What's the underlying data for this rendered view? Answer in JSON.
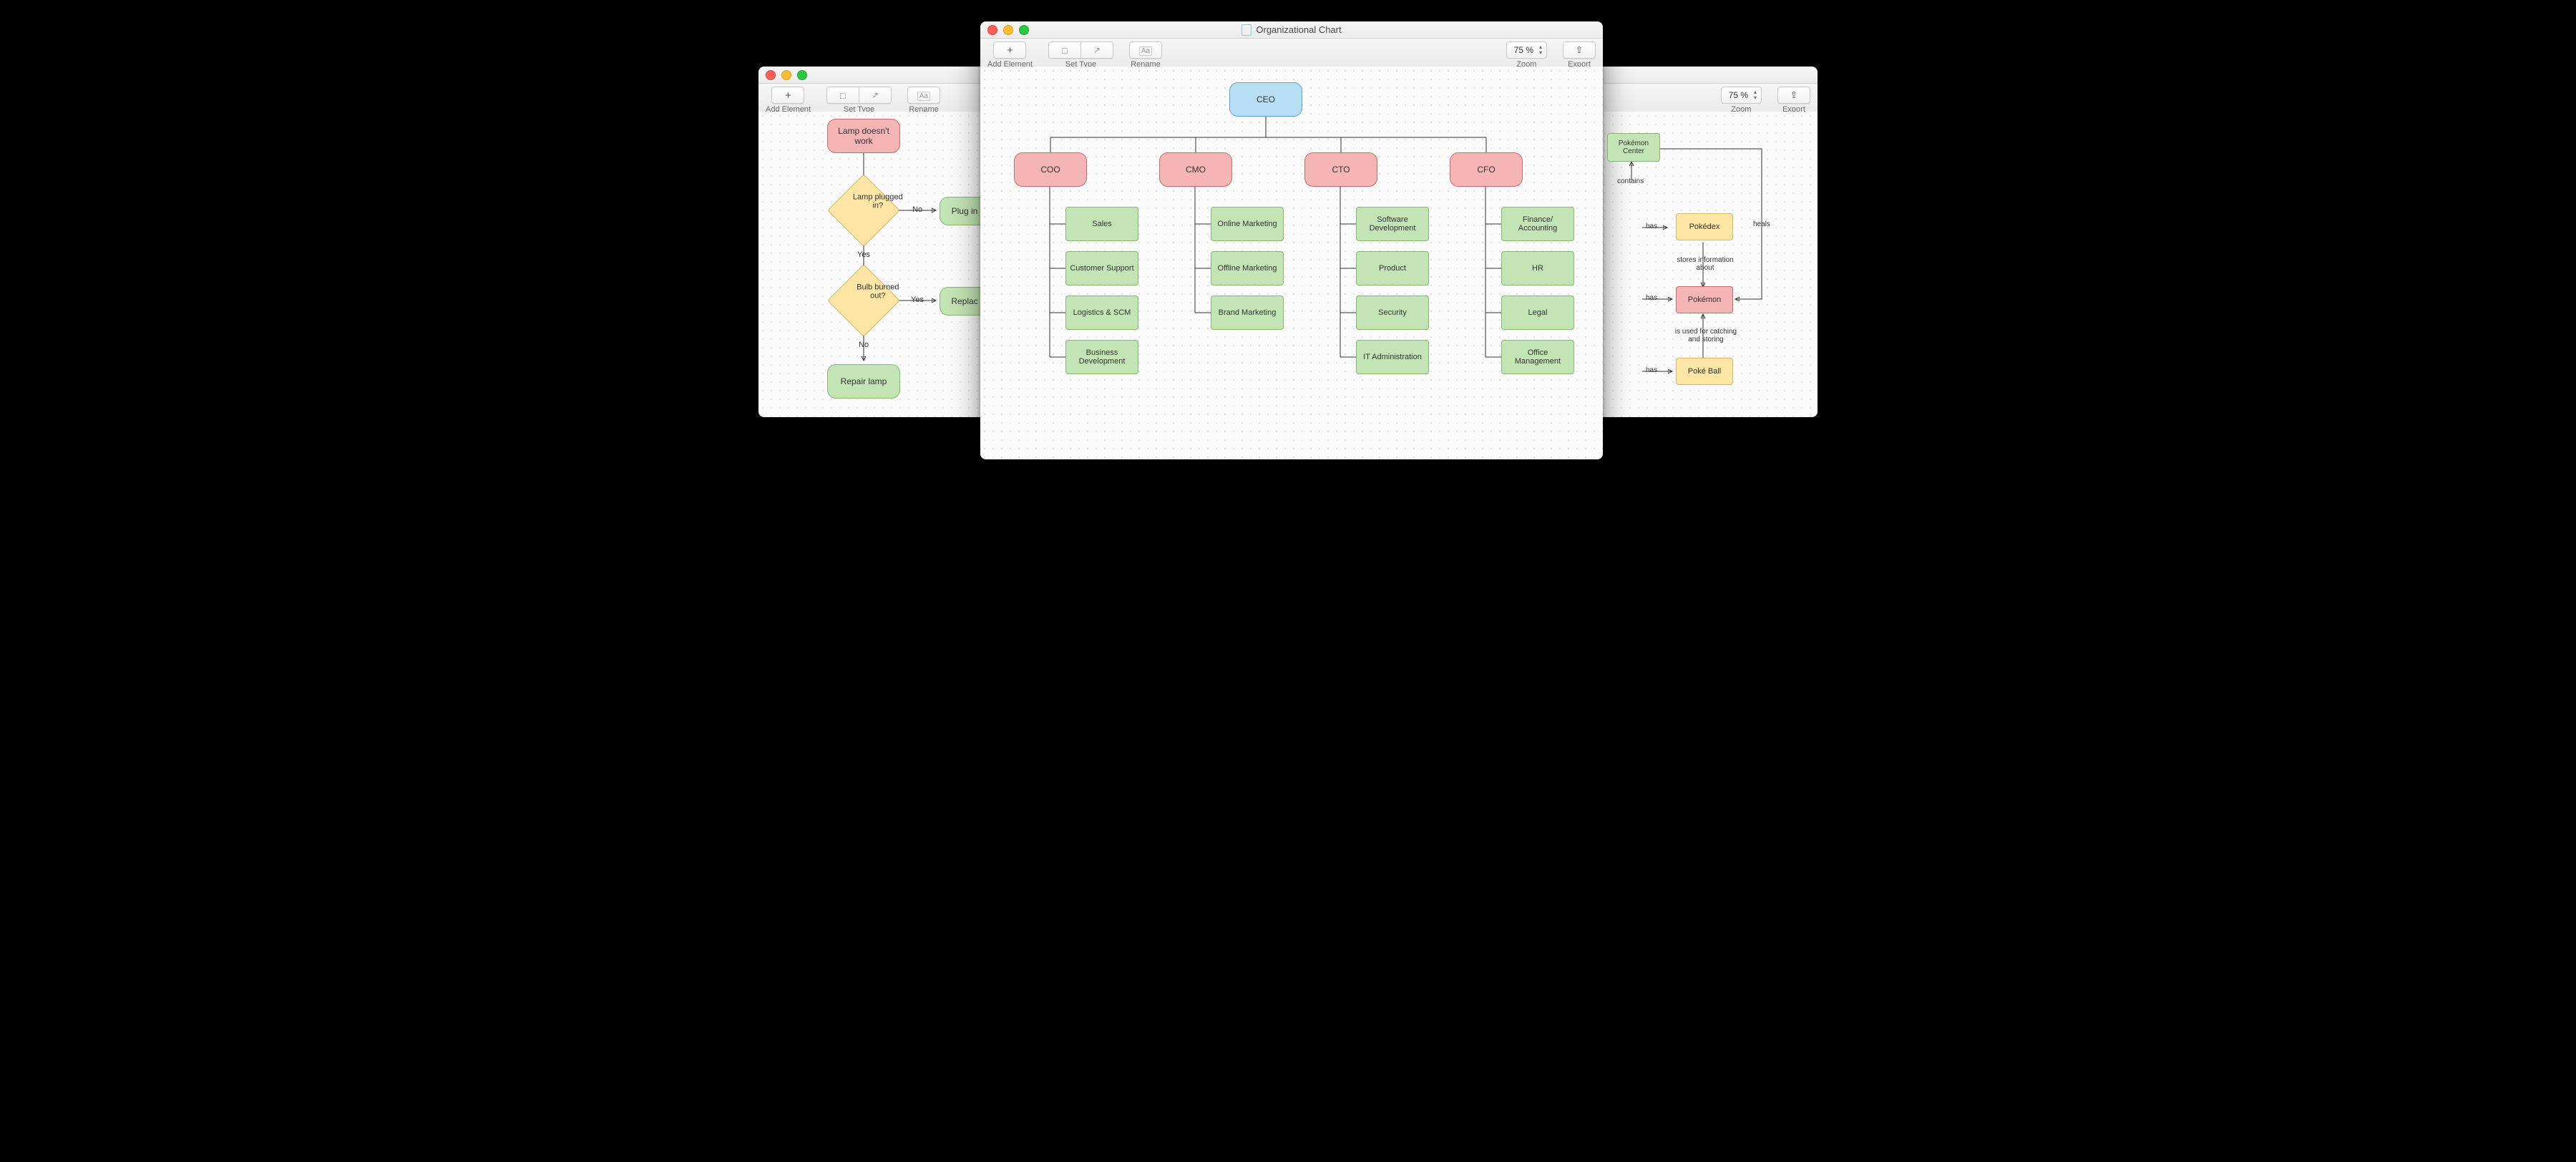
{
  "toolbar": {
    "add_element": "Add Element",
    "set_type": "Set Type",
    "rename": "Rename",
    "zoom": "Zoom",
    "export": "Export"
  },
  "windows": {
    "left": {
      "zoom_value": "75 %",
      "nodes": {
        "start": "Lamp doesn't work",
        "q1": "Lamp plugged in?",
        "q2": "Bulb burned out?",
        "plug": "Plug in",
        "replace": "Replac",
        "repair": "Repair lamp",
        "no": "No",
        "yes": "Yes",
        "no2": "No",
        "yes2": "Yes"
      }
    },
    "center": {
      "title": "Organizational Chart",
      "zoom_value": "75 %",
      "ceo": "CEO",
      "cols": [
        {
          "head": "COO",
          "items": [
            "Sales",
            "Customer Support",
            "Logistics & SCM",
            "Business Development"
          ]
        },
        {
          "head": "CMO",
          "items": [
            "Online Marketing",
            "Offline Marketing",
            "Brand Marketing"
          ]
        },
        {
          "head": "CTO",
          "items": [
            "Software Development",
            "Product",
            "Security",
            "IT Administration"
          ]
        },
        {
          "head": "CFO",
          "items": [
            "Finance/ Accounting",
            "HR",
            "Legal",
            "Office Management"
          ]
        }
      ]
    },
    "right": {
      "zoom_value": "75 %",
      "nodes": {
        "center": "Pokémon Center",
        "pokedex": "Pokédex",
        "pokemon": "Pokémon",
        "pokeball": "Poké Ball"
      },
      "edges": {
        "contains": "contains",
        "has": "has",
        "heals": "heals",
        "stores": "stores information about",
        "catching": "is used for catching and storing"
      }
    }
  }
}
